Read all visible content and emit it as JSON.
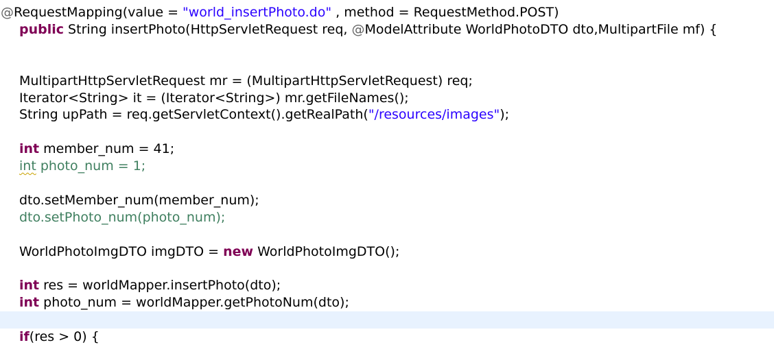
{
  "code": {
    "l1": {
      "annotation": "@",
      "a": "RequestMapping(value = ",
      "str": "\"world_insertPhoto.do\"",
      "b": " , method = RequestMethod.POST)"
    },
    "l2": {
      "kw": "public",
      "a": " String insertPhoto(HttpServletRequest req, ",
      "annotation": "@",
      "b": "ModelAttribute WorldPhotoDTO dto,MultipartFile mf) {"
    },
    "l3": {
      "text": "MultipartHttpServletRequest mr = (MultipartHttpServletRequest) req;"
    },
    "l4": {
      "text": "Iterator<String> it = (Iterator<String>) mr.getFileNames();"
    },
    "l5": {
      "a": "String upPath = req.getServletContext().getRealPath(",
      "str": "\"/resources/images\"",
      "b": ");"
    },
    "l6": {
      "kw": "int",
      "a": " member_num = 41;"
    },
    "l7": {
      "kw": "int",
      "a": " photo_num = 1;"
    },
    "l8": {
      "text": "dto.setMember_num(member_num);"
    },
    "l9": {
      "text": "dto.setPhoto_num(photo_num);"
    },
    "l10": {
      "a": "WorldPhotoImgDTO imgDTO = ",
      "kw": "new",
      "b": " WorldPhotoImgDTO();"
    },
    "l11": {
      "kw": "int",
      "a": " res = worldMapper.insertPhoto(dto);"
    },
    "l12": {
      "kw": "int",
      "a": " photo_num = worldMapper.getPhotoNum(dto);"
    },
    "l13": {
      "kw": "if",
      "a": "(res > 0) {"
    }
  },
  "colors": {
    "keyword": "#7f0055",
    "string": "#2a00ff",
    "annotation": "#646464",
    "unused": "#3f7f5f",
    "current_line": "#e8f2fe"
  }
}
